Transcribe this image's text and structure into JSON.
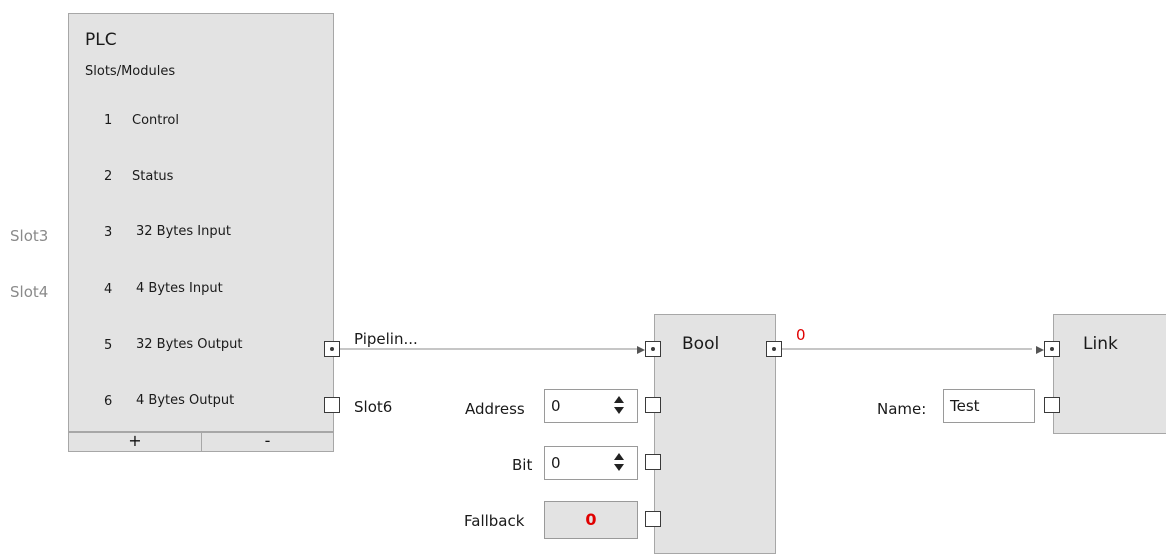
{
  "plc": {
    "title": "PLC",
    "subtitle": "Slots/Modules",
    "slots": [
      {
        "num": "1",
        "label": "Control"
      },
      {
        "num": "2",
        "label": "Status"
      },
      {
        "num": "3",
        "label": "32 Bytes Input",
        "side_label": "Slot3"
      },
      {
        "num": "4",
        "label": "4 Bytes Input",
        "side_label": "Slot4"
      },
      {
        "num": "5",
        "label": "32 Bytes Output",
        "out_label": "Pipelin..."
      },
      {
        "num": "6",
        "label": "4 Bytes Output",
        "out_label": "Slot6"
      }
    ],
    "add_label": "+",
    "remove_label": "-"
  },
  "bool_node": {
    "title": "Bool",
    "output_value": "0",
    "address_label": "Address",
    "address_value": "0",
    "bit_label": "Bit",
    "bit_value": "0",
    "fallback_label": "Fallback",
    "fallback_value": "0"
  },
  "link_node": {
    "title": "Link",
    "name_label": "Name:",
    "name_value": "Test"
  },
  "colors": {
    "node_bg": "#e3e3e3",
    "value_red": "#e00000",
    "wire": "#c6c6c6"
  }
}
